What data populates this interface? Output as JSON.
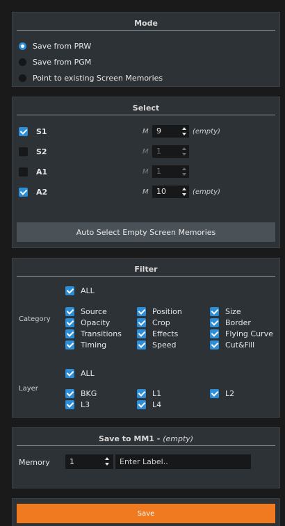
{
  "mode": {
    "title": "Mode",
    "options": [
      {
        "label": "Save from PRW",
        "selected": true
      },
      {
        "label": "Save from PGM",
        "selected": false
      },
      {
        "label": "Point to existing Screen Memories",
        "selected": false
      }
    ]
  },
  "select": {
    "title": "Select",
    "m_label": "M",
    "rows": [
      {
        "label": "S1",
        "checked": true,
        "value": "9",
        "note": "(empty)",
        "enabled": true
      },
      {
        "label": "S2",
        "checked": false,
        "value": "1",
        "note": "",
        "enabled": false
      },
      {
        "label": "A1",
        "checked": false,
        "value": "1",
        "note": "",
        "enabled": false
      },
      {
        "label": "A2",
        "checked": true,
        "value": "10",
        "note": "(empty)",
        "enabled": true
      }
    ],
    "auto_button": "Auto Select Empty Screen Memories"
  },
  "filter": {
    "title": "Filter",
    "category_label": "Category",
    "layer_label": "Layer",
    "category_all": "ALL",
    "categories": [
      "Source",
      "Position",
      "Size",
      "Opacity",
      "Crop",
      "Border",
      "Transitions",
      "Effects",
      "Flying Curve",
      "Timing",
      "Speed",
      "Cut&Fill"
    ],
    "layer_all": "ALL",
    "layers": [
      "BKG",
      "L1",
      "L2",
      "L3",
      "L4"
    ]
  },
  "save_to": {
    "title": "Save to MM1 -",
    "title_note": "(empty)",
    "memory_label": "Memory",
    "memory_value": "1",
    "label_placeholder": "Enter Label.."
  },
  "save_button": "Save",
  "colors": {
    "accent": "#2d8ed8",
    "save": "#f07a1f",
    "panel": "#2d3236",
    "background": "#1a1a1a"
  }
}
